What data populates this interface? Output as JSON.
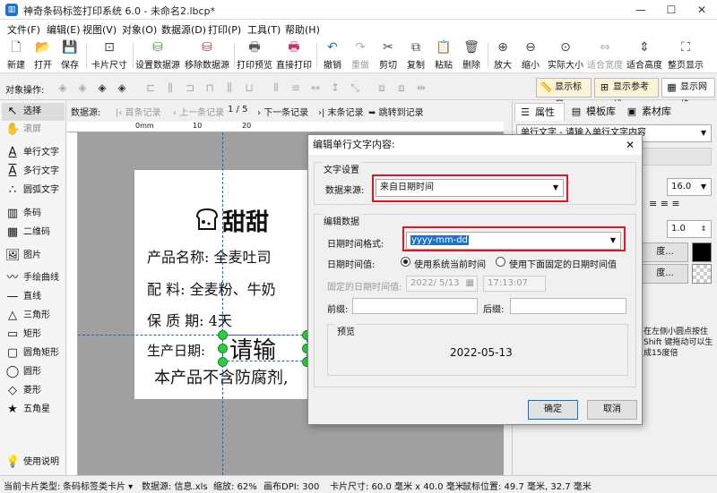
{
  "app": {
    "title": "神奇条码标签打印系统 6.0 - 未命名2.lbcp*",
    "icon": "barcode-app-icon"
  },
  "window": {
    "minimize": "—",
    "maximize": "☐",
    "close": "✕"
  },
  "menus": [
    "文件(F)",
    "编辑(E)",
    "视图(V)",
    "对象(O)",
    "数据源(D)",
    "打印(P)",
    "工具(T)",
    "帮助(H)"
  ],
  "toolbar": [
    {
      "label": "新建",
      "icon": "new-file-icon",
      "glyph": "🗋"
    },
    {
      "label": "打开",
      "icon": "open-folder-icon",
      "glyph": "📂"
    },
    {
      "label": "保存",
      "icon": "save-icon",
      "glyph": "💾"
    },
    {
      "label": "卡片尺寸",
      "icon": "card-size-icon",
      "glyph": "⊡"
    },
    {
      "label": "设置数据源",
      "icon": "database-icon",
      "glyph": "⛁"
    },
    {
      "label": "移除数据源",
      "icon": "remove-database-icon",
      "glyph": "⛁"
    },
    {
      "label": "打印预览",
      "icon": "print-preview-icon",
      "glyph": "🖶"
    },
    {
      "label": "直接打印",
      "icon": "print-icon",
      "glyph": "🖶"
    },
    {
      "label": "撤销",
      "icon": "undo-icon",
      "glyph": "↶"
    },
    {
      "label": "重做",
      "icon": "redo-icon",
      "glyph": "↷"
    },
    {
      "label": "剪切",
      "icon": "cut-icon",
      "glyph": "✂"
    },
    {
      "label": "复制",
      "icon": "copy-icon",
      "glyph": "⧉"
    },
    {
      "label": "粘贴",
      "icon": "paste-icon",
      "glyph": "📋"
    },
    {
      "label": "删除",
      "icon": "delete-icon",
      "glyph": "🗑"
    },
    {
      "label": "放大",
      "icon": "zoom-in-icon",
      "glyph": "⊕"
    },
    {
      "label": "缩小",
      "icon": "zoom-out-icon",
      "glyph": "⊖"
    },
    {
      "label": "实际大小",
      "icon": "actual-size-icon",
      "glyph": "⊙"
    },
    {
      "label": "适合宽度",
      "icon": "fit-width-icon",
      "glyph": "⇔"
    },
    {
      "label": "适合高度",
      "icon": "fit-height-icon",
      "glyph": "⇕"
    },
    {
      "label": "整页显示",
      "icon": "fit-page-icon",
      "glyph": "⛶"
    }
  ],
  "objbar": {
    "label": "对象操作:",
    "toggles": [
      "显示标尺",
      "显示参考线",
      "显示网格"
    ]
  },
  "tools": [
    {
      "label": "选择",
      "icon": "pointer-icon",
      "glyph": "↖"
    },
    {
      "label": "滚屏",
      "icon": "hand-icon",
      "glyph": "✋"
    },
    {
      "label": "单行文字",
      "icon": "single-line-text-icon",
      "glyph": "A"
    },
    {
      "label": "多行文字",
      "icon": "multi-line-text-icon",
      "glyph": "A"
    },
    {
      "label": "圆弧文字",
      "icon": "arc-text-icon",
      "glyph": "∴"
    },
    {
      "label": "条码",
      "icon": "barcode-icon",
      "glyph": "▥"
    },
    {
      "label": "二维码",
      "icon": "qrcode-icon",
      "glyph": "▦"
    },
    {
      "label": "图片",
      "icon": "image-icon",
      "glyph": "🖼"
    },
    {
      "label": "手绘曲线",
      "icon": "freehand-curve-icon",
      "glyph": "〰"
    },
    {
      "label": "直线",
      "icon": "line-icon",
      "glyph": "—"
    },
    {
      "label": "三角形",
      "icon": "triangle-icon",
      "glyph": "△"
    },
    {
      "label": "矩形",
      "icon": "rectangle-icon",
      "glyph": "▭"
    },
    {
      "label": "圆角矩形",
      "icon": "rounded-rectangle-icon",
      "glyph": "▢"
    },
    {
      "label": "圆形",
      "icon": "ellipse-icon",
      "glyph": "◯"
    },
    {
      "label": "菱形",
      "icon": "diamond-icon",
      "glyph": "◇"
    },
    {
      "label": "五角星",
      "icon": "star-icon",
      "glyph": "★"
    }
  ],
  "help": {
    "label": "使用说明",
    "icon": "lightbulb-icon"
  },
  "datanav": {
    "label": "数据源:",
    "first": "首条记录",
    "prev": "上一条记录",
    "page": "1 / 5",
    "next": "下一条记录",
    "last": "末条记录",
    "jump": "跳转到记录"
  },
  "ruler": {
    "marks": [
      "0mm",
      "10",
      "20"
    ]
  },
  "label": {
    "brand": "甜甜",
    "rows": [
      {
        "key": "产品名称:",
        "val": "全麦吐司"
      },
      {
        "key": "配      料:",
        "val": "全麦粉、牛奶"
      },
      {
        "key": "保 质 期:",
        "val": "4天"
      },
      {
        "key": "生产日期:",
        "val": "请输"
      }
    ],
    "footer": "本产品不含防腐剂,"
  },
  "rightpanel": {
    "tabs": [
      "属性栏",
      "模板库",
      "素材库"
    ],
    "object_select": "单行文字 - 请输入单行文字内容",
    "font_size": "16.0",
    "spacing": "1.0",
    "hint": "在左侧小圆点按住 Shift 键拖动可以生成15度倍"
  },
  "dialog": {
    "title": "编辑单行文字内容:",
    "group1": "文字设置",
    "source_label": "数据来源:",
    "source_value": "来自日期时间",
    "group2": "编辑数据",
    "format_label": "日期时间格式:",
    "format_value": "yyyy-mm-dd",
    "value_label": "日期时间值:",
    "radio_system": "使用系统当前时间",
    "radio_fixed": "使用下面固定的日期时间值",
    "fixed_label": "固定的日期时间值:",
    "fixed_date": "2022/ 5/13",
    "fixed_time": "17:13:07",
    "prefix_label": "前缀:",
    "suffix_label": "后缀:",
    "preview_label": "预览",
    "preview_value": "2022-05-13",
    "ok": "确定",
    "cancel": "取消"
  },
  "status": {
    "card_type": "当前卡片类型:",
    "card_type_value": "条码标签类卡片",
    "datasource": "数据源: 信息.xls",
    "zoom": "缩放: 62%",
    "dpi": "画布DPI: 300",
    "card_size": "卡片尺寸: 60.0 毫米 x 40.0 毫米",
    "mouse": "鼠标位置: 49.7 毫米, 32.7 毫米"
  },
  "colors": {
    "accent": "#1e73c8",
    "highlight_border": "#d8182a",
    "selection": "#2ecc40"
  }
}
